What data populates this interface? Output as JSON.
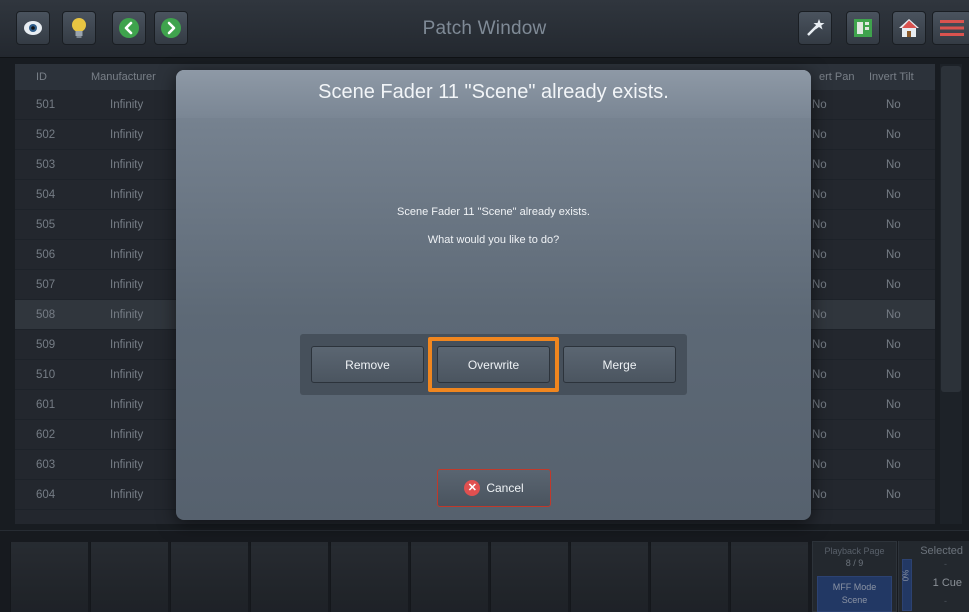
{
  "window": {
    "title": "Patch Window"
  },
  "table": {
    "headers": {
      "id": "ID",
      "manufacturer": "Manufacturer",
      "invert_pan": "ert Pan",
      "invert_tilt": "Invert Tilt"
    },
    "rows": [
      {
        "id": "501",
        "manufacturer": "Infinity",
        "pan": "No",
        "tilt": "No"
      },
      {
        "id": "502",
        "manufacturer": "Infinity",
        "pan": "No",
        "tilt": "No"
      },
      {
        "id": "503",
        "manufacturer": "Infinity",
        "pan": "No",
        "tilt": "No"
      },
      {
        "id": "504",
        "manufacturer": "Infinity",
        "pan": "No",
        "tilt": "No"
      },
      {
        "id": "505",
        "manufacturer": "Infinity",
        "pan": "No",
        "tilt": "No"
      },
      {
        "id": "506",
        "manufacturer": "Infinity",
        "pan": "No",
        "tilt": "No"
      },
      {
        "id": "507",
        "manufacturer": "Infinity",
        "pan": "No",
        "tilt": "No"
      },
      {
        "id": "508",
        "manufacturer": "Infinity",
        "pan": "No",
        "tilt": "No"
      },
      {
        "id": "509",
        "manufacturer": "Infinity",
        "pan": "No",
        "tilt": "No"
      },
      {
        "id": "510",
        "manufacturer": "Infinity",
        "pan": "No",
        "tilt": "No"
      },
      {
        "id": "601",
        "manufacturer": "Infinity",
        "pan": "No",
        "tilt": "No"
      },
      {
        "id": "602",
        "manufacturer": "Infinity",
        "pan": "No",
        "tilt": "No"
      },
      {
        "id": "603",
        "manufacturer": "Infinity",
        "pan": "No",
        "tilt": "No"
      },
      {
        "id": "604",
        "manufacturer": "Infinity",
        "pan": "No",
        "tilt": "No"
      }
    ],
    "selected_id": "508"
  },
  "dialog": {
    "title": "Scene Fader 11 \"Scene\" already exists.",
    "message_line1": "Scene Fader 11 \"Scene\" already exists.",
    "message_line2": "What would you like to do?",
    "remove_label": "Remove",
    "overwrite_label": "Overwrite",
    "merge_label": "Merge",
    "cancel_label": "Cancel",
    "highlighted_option": "overwrite"
  },
  "playback": {
    "page_label": "Playback Page",
    "page_value": "8 / 9",
    "mff_label": "MFF Mode",
    "mff_value": "Scene"
  },
  "selected_panel": {
    "title": "Selected",
    "top_value": "-",
    "percent": "0%",
    "cue": "1 Cue",
    "bottom_value": "-"
  },
  "icons": {
    "toolbar_left": [
      "eye-icon",
      "lightbulb-icon",
      "back-arrow-icon",
      "forward-arrow-icon"
    ],
    "toolbar_right": [
      "magic-wand-icon",
      "layout-icon",
      "home-icon",
      "menu-icon"
    ]
  },
  "colors": {
    "highlight": "#f0861f",
    "cancel_border": "#c0392b",
    "green_accent": "#3fa34d",
    "blue_accent": "#2a4a8a"
  }
}
